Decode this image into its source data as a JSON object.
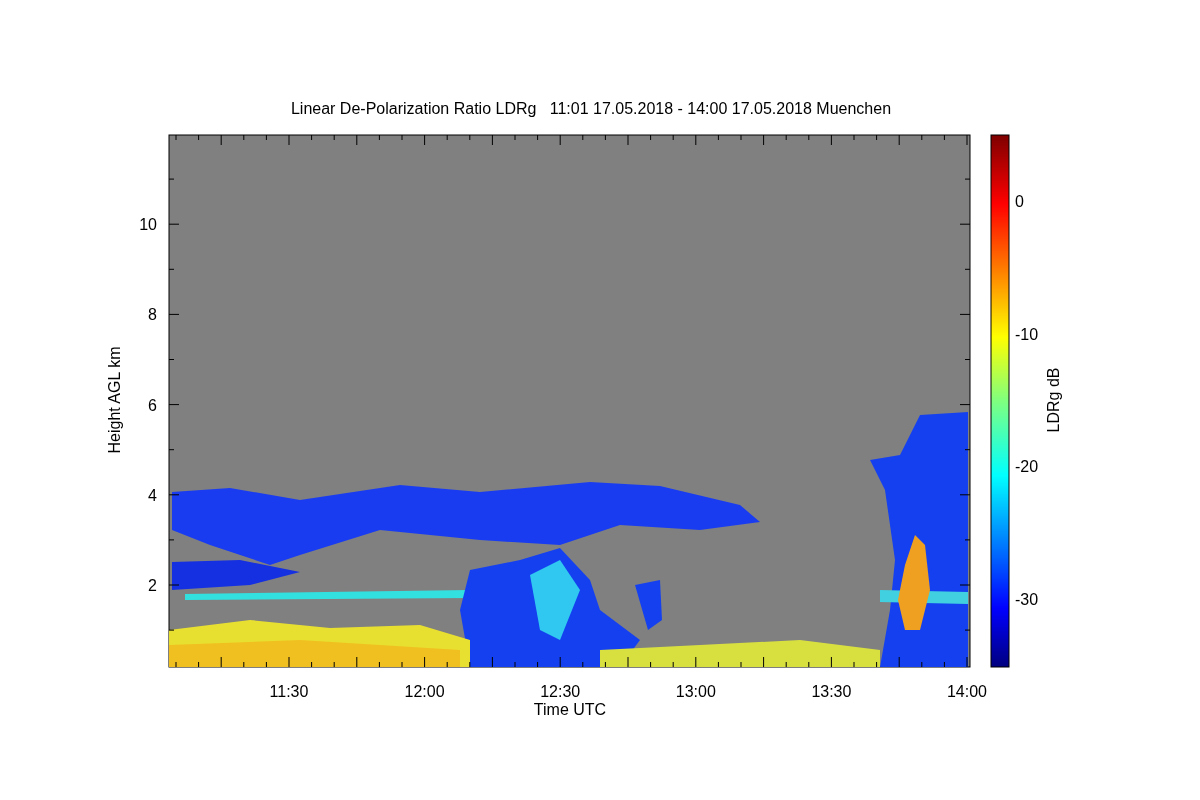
{
  "title": "Linear De-Polarization Ratio LDRg   11:01 17.05.2018 - 14:00 17.05.2018 Muenchen",
  "x_axis": {
    "label": "Time UTC",
    "ticks": [
      "11:30",
      "12:00",
      "12:30",
      "13:00",
      "13:30",
      "14:00"
    ]
  },
  "y_axis": {
    "label": "Height AGL km",
    "ticks": [
      "10",
      "8",
      "6",
      "4",
      "2"
    ]
  },
  "colorbar": {
    "label": "LDRg dB",
    "ticks": [
      "0",
      "-10",
      "-20",
      "-30"
    ]
  }
}
